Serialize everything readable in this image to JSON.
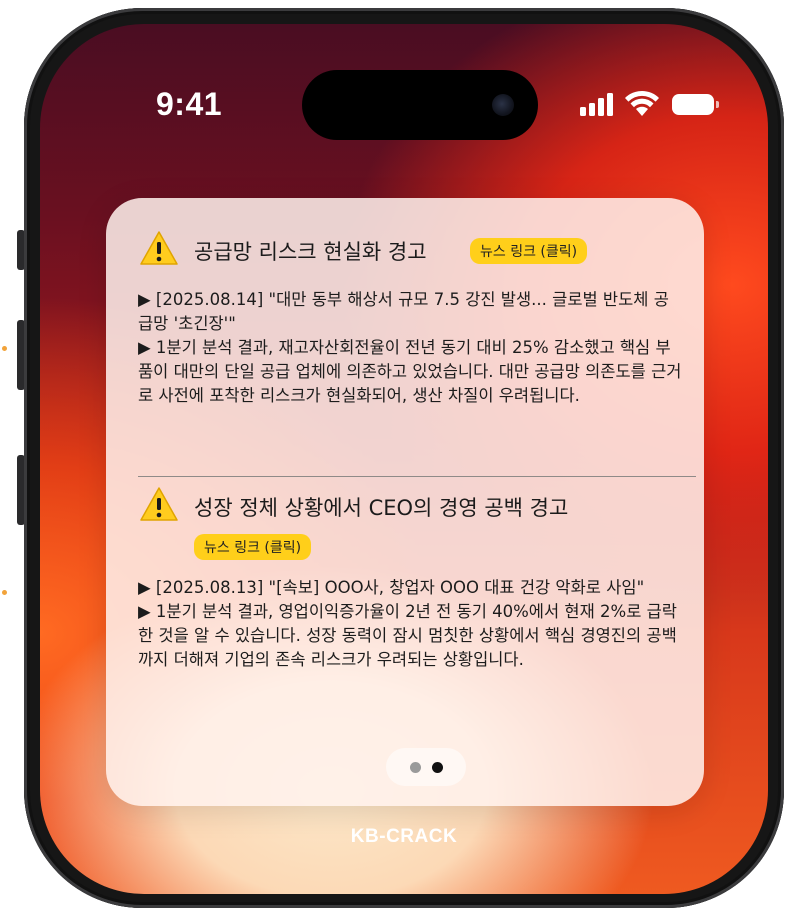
{
  "status_bar": {
    "time": "9:41",
    "signal_icon": "cellular-signal-icon",
    "wifi_icon": "wifi-icon",
    "battery_icon": "battery-icon"
  },
  "notification": {
    "alerts": [
      {
        "icon": "warning-icon",
        "title": "공급망 리스크 현실화 경고",
        "badge": "뉴스 링크 (클릭)",
        "news_line": "▶ [2025.08.14] \"대만 동부 해상서 규모 7.5 강진 발생... 글로벌 반도체 공급망 '초긴장'\"",
        "analysis_line": "▶ 1분기 분석 결과, 재고자산회전율이 전년 동기 대비 25% 감소했고 핵심 부품이 대만의 단일 공급 업체에 의존하고 있었습니다. 대만 공급망 의존도를 근거로 사전에 포착한 리스크가 현실화되어, 생산 차질이 우려됩니다."
      },
      {
        "icon": "warning-icon",
        "title": "성장 정체 상황에서 CEO의 경영 공백 경고",
        "badge": "뉴스 링크 (클릭)",
        "news_line": "▶ [2025.08.13] \"[속보] OOO사, 창업자 OOO 대표 건강 악화로 사임\"",
        "analysis_line": "▶ 1분기 분석 결과, 영업이익증가율이 2년 전 동기 40%에서 현재 2%로 급락한 것을 알 수 있습니다. 성장 동력이 잠시 멈칫한 상황에서 핵심 경영진의 공백까지 더해져 기업의 존속 리스크가 우려되는 상황입니다."
      }
    ],
    "pager": {
      "pages": 2,
      "current": 2
    }
  },
  "app_name": "KB-CRACK",
  "colors": {
    "badge": "#ffcf1a",
    "dot_active": "#111111",
    "dot_inactive": "#9a9a9a"
  }
}
